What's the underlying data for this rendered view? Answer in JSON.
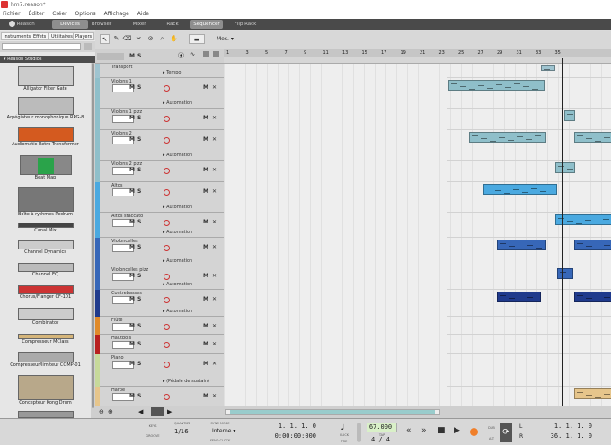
{
  "window": {
    "title": "hm7.reason*"
  },
  "menu": [
    "Fichier",
    "Éditer",
    "Créer",
    "Options",
    "Affichage",
    "Aide"
  ],
  "tabs": {
    "reason": "Reason",
    "devices": "Devices",
    "browser": "Browser",
    "mixer": "Mixer",
    "rack": "Rack",
    "sequencer": "Sequencer",
    "fliprack": "Flip Rack"
  },
  "left": {
    "tabs": [
      "Instruments",
      "Effets",
      "Utilitaires",
      "Players"
    ],
    "section": "Reason Studios",
    "devices": [
      "Alligator Filter Gate",
      "Arpégiateur monophonique RPG-8",
      "Audiomatic Retro Transformer",
      "Beat Map",
      "Boîte à rythmes Redrum",
      "Canal Mix",
      "Channel Dynamics",
      "Channel EQ",
      "Chorus/Flanger CF-101",
      "Combinator",
      "Compresseur MClass",
      "Compresseur/limiteur COMP-01",
      "Concepteur Kong Drum"
    ]
  },
  "toolbar": {
    "snap": "Mes."
  },
  "ruler": [
    "1",
    "3",
    "5",
    "7",
    "9",
    "11",
    "13",
    "15",
    "17",
    "19",
    "21",
    "23",
    "25",
    "27",
    "29",
    "31",
    "33",
    "35"
  ],
  "tracks": {
    "tempo": "Tempo",
    "automation": "Automation",
    "cc": "(Pédale de sustain)",
    "items": [
      {
        "name": "Transport",
        "color": "#9fc4d0"
      },
      {
        "name": "Violons 1",
        "color": "#8fbfca"
      },
      {
        "name": "Violons 1 pizz",
        "color": "#8fbfca"
      },
      {
        "name": "Violons 2",
        "color": "#8fbfca"
      },
      {
        "name": "Violons 2 pizz",
        "color": "#8fbfca"
      },
      {
        "name": "Altos",
        "color": "#4aa9e0"
      },
      {
        "name": "Altos staccato",
        "color": "#4aa9e0"
      },
      {
        "name": "Violoncelles",
        "color": "#3767b8"
      },
      {
        "name": "Violoncelles pizz",
        "color": "#3767b8"
      },
      {
        "name": "Contrebasses",
        "color": "#1f3a8c"
      },
      {
        "name": "Flûte",
        "color": "#e08a2a"
      },
      {
        "name": "Hautbois",
        "color": "#b8201f"
      },
      {
        "name": "Piano",
        "color": "#c7d99a"
      },
      {
        "name": "Harpe",
        "color": "#e6c58b"
      }
    ]
  },
  "transport": {
    "keys_label": "KEYS",
    "groove_label": "GROOVE",
    "quantize_label": "QUANTIZE",
    "quantize": "1/16",
    "sync_mode_label": "SYNC MODE",
    "sync_mode": "Interne",
    "send_clock": "SEND CLOCK",
    "position": "1.  1.  1.    0",
    "time": "0:00:00:000",
    "click_label": "CLICK",
    "pre_label": "PRE",
    "tap_label": "TAP",
    "tempo": "67.000",
    "signature": "4 / 4",
    "dub_label": "DUB",
    "alt_label": "ALT",
    "loop_l": "1.  1.  1.    0",
    "loop_r": "36.  1.  1.    0",
    "l_label": "L",
    "r_label": "R"
  },
  "colors": {
    "accent": "#f07f2a",
    "rec": "#e84a3f",
    "tempo_lcd": "#d9f0c8"
  }
}
